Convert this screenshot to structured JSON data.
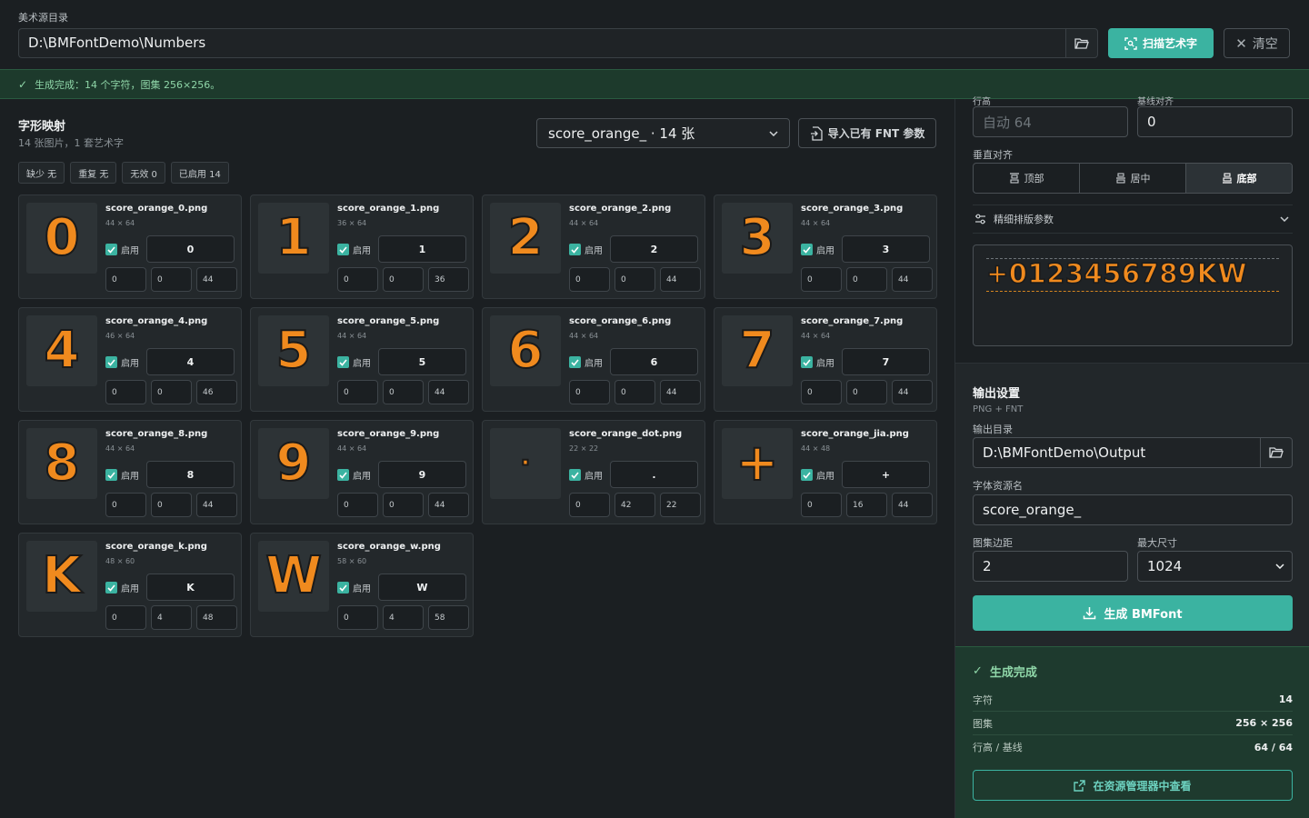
{
  "top": {
    "source_label": "美术源目录",
    "source_path": "D:\\BMFontDemo\\Numbers",
    "scan_label": "扫描艺术字",
    "clear_label": "清空"
  },
  "status": {
    "text": "生成完成：14 个字符，图集 256×256。"
  },
  "glyph_map": {
    "title": "字形映射",
    "subtitle": "14 张图片，1 套艺术字",
    "set_select": "score_orange_ · 14 张",
    "import_label": "导入已有 FNT 参数",
    "chips": [
      "缺少 无",
      "重复 无",
      "无效 0",
      "已启用 14"
    ],
    "enable_label": "启用",
    "cards": [
      {
        "glyph": "0",
        "file": "score_orange_0.png",
        "size": "44 × 64",
        "char": "0",
        "x": "0",
        "y": "0",
        "adv": "44"
      },
      {
        "glyph": "1",
        "file": "score_orange_1.png",
        "size": "36 × 64",
        "char": "1",
        "x": "0",
        "y": "0",
        "adv": "36"
      },
      {
        "glyph": "2",
        "file": "score_orange_2.png",
        "size": "44 × 64",
        "char": "2",
        "x": "0",
        "y": "0",
        "adv": "44"
      },
      {
        "glyph": "3",
        "file": "score_orange_3.png",
        "size": "44 × 64",
        "char": "3",
        "x": "0",
        "y": "0",
        "adv": "44"
      },
      {
        "glyph": "4",
        "file": "score_orange_4.png",
        "size": "46 × 64",
        "char": "4",
        "x": "0",
        "y": "0",
        "adv": "46"
      },
      {
        "glyph": "5",
        "file": "score_orange_5.png",
        "size": "44 × 64",
        "char": "5",
        "x": "0",
        "y": "0",
        "adv": "44"
      },
      {
        "glyph": "6",
        "file": "score_orange_6.png",
        "size": "44 × 64",
        "char": "6",
        "x": "0",
        "y": "0",
        "adv": "44"
      },
      {
        "glyph": "7",
        "file": "score_orange_7.png",
        "size": "44 × 64",
        "char": "7",
        "x": "0",
        "y": "0",
        "adv": "44"
      },
      {
        "glyph": "8",
        "file": "score_orange_8.png",
        "size": "44 × 64",
        "char": "8",
        "x": "0",
        "y": "0",
        "adv": "44"
      },
      {
        "glyph": "9",
        "file": "score_orange_9.png",
        "size": "44 × 64",
        "char": "9",
        "x": "0",
        "y": "0",
        "adv": "44"
      },
      {
        "glyph": "·",
        "file": "score_orange_dot.png",
        "size": "22 × 22",
        "char": ".",
        "x": "0",
        "y": "42",
        "adv": "22",
        "small": true
      },
      {
        "glyph": "+",
        "file": "score_orange_jia.png",
        "size": "44 × 48",
        "char": "+",
        "x": "0",
        "y": "16",
        "adv": "44"
      },
      {
        "glyph": "K",
        "file": "score_orange_k.png",
        "size": "48 × 60",
        "char": "K",
        "x": "0",
        "y": "4",
        "adv": "48"
      },
      {
        "glyph": "W",
        "file": "score_orange_w.png",
        "size": "58 × 60",
        "char": "W",
        "x": "0",
        "y": "4",
        "adv": "58"
      }
    ]
  },
  "layout": {
    "cut_label_a": "行高",
    "cut_label_b": "基线对齐",
    "line_height_placeholder": "自动 64",
    "baseline_value": "0",
    "valign_label": "垂直对齐",
    "valign_options": [
      "顶部",
      "居中",
      "底部"
    ],
    "valign_active": 2,
    "fine_label": "精细排版参数",
    "preview_text": "+0123456789KW"
  },
  "output": {
    "title": "输出设置",
    "subtitle": "PNG + FNT",
    "dir_label": "输出目录",
    "dir_value": "D:\\BMFontDemo\\Output",
    "name_label": "字体资源名",
    "name_value": "score_orange_",
    "padding_label": "图集边距",
    "padding_value": "2",
    "max_label": "最大尺寸",
    "max_value": "1024",
    "generate_label": "生成 BMFont"
  },
  "result": {
    "title": "生成完成",
    "rows": [
      {
        "k": "字符",
        "v": "14"
      },
      {
        "k": "图集",
        "v": "256 × 256"
      },
      {
        "k": "行高 / 基线",
        "v": "64 / 64"
      }
    ],
    "explorer_label": "在资源管理器中查看"
  },
  "colors": {
    "accent": "#3bb3a1",
    "glyph_orange": "#f08a1e",
    "success_bg": "#1e3a2e"
  }
}
